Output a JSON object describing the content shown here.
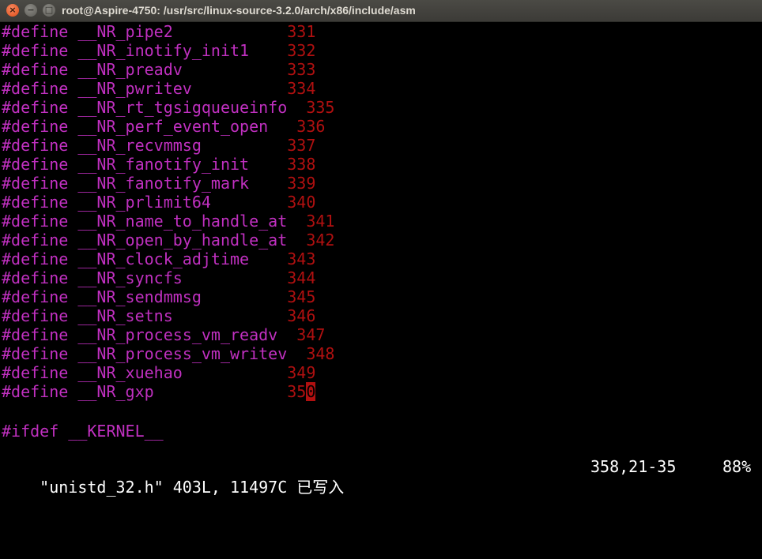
{
  "window": {
    "title": "root@Aspire-4750: /usr/src/linux-source-3.2.0/arch/x86/include/asm",
    "close_glyph": "×",
    "minimize_glyph": "−",
    "maximize_glyph": "□"
  },
  "editor": {
    "lines": [
      {
        "text": "#define __NR_pipe2          ",
        "num": "331"
      },
      {
        "text": "#define __NR_inotify_init1  ",
        "num": "332"
      },
      {
        "text": "#define __NR_preadv         ",
        "num": "333"
      },
      {
        "text": "#define __NR_pwritev        ",
        "num": "334"
      },
      {
        "text": "#define __NR_rt_tgsigqueueinfo",
        "num": "335"
      },
      {
        "text": "#define __NR_perf_event_open ",
        "num": "336"
      },
      {
        "text": "#define __NR_recvmmsg       ",
        "num": "337"
      },
      {
        "text": "#define __NR_fanotify_init  ",
        "num": "338"
      },
      {
        "text": "#define __NR_fanotify_mark  ",
        "num": "339"
      },
      {
        "text": "#define __NR_prlimit64      ",
        "num": "340"
      },
      {
        "text": "#define __NR_name_to_handle_at",
        "num": "341"
      },
      {
        "text": "#define __NR_open_by_handle_at",
        "num": "342"
      },
      {
        "text": "#define __NR_clock_adjtime  ",
        "num": "343"
      },
      {
        "text": "#define __NR_syncfs         ",
        "num": "344"
      },
      {
        "text": "#define __NR_sendmmsg       ",
        "num": "345"
      },
      {
        "text": "#define __NR_setns          ",
        "num": "346"
      },
      {
        "text": "#define __NR_process_vm_readv",
        "num": "347"
      },
      {
        "text": "#define __NR_process_vm_writev",
        "num": "348"
      },
      {
        "text": "#define __NR_xuehao         ",
        "num": "349"
      },
      {
        "text": "#define __NR_gxp            ",
        "num": "35",
        "cursor_char": "0"
      }
    ],
    "ifdef_line": "#ifdef __KERNEL__"
  },
  "status": {
    "file_info": "\"unistd_32.h\" 403L, 11497C 已写入",
    "position": "358,21-35",
    "percent": "88%"
  },
  "colors": {
    "keyword": "#c030c0",
    "number": "#b01010",
    "background": "#000000",
    "titlebar": "#3c3b37"
  }
}
